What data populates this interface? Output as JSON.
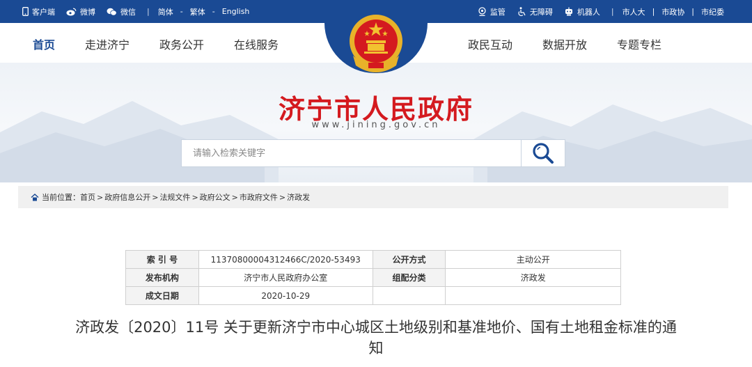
{
  "topbar": {
    "left": [
      {
        "icon": "mobile-icon",
        "label": "客户端"
      },
      {
        "icon": "weibo-icon",
        "label": "微博"
      },
      {
        "icon": "wechat-icon",
        "label": "微信"
      }
    ],
    "sep": "|",
    "lang": {
      "simplified": "简体",
      "dash": "-",
      "traditional": "繁体",
      "english": "English"
    },
    "right": [
      {
        "icon": "supervision-icon",
        "label": "监管"
      },
      {
        "icon": "accessibility-icon",
        "label": "无障碍"
      },
      {
        "icon": "robot-icon",
        "label": "机器人"
      }
    ],
    "links": [
      "市人大",
      "市政协",
      "市纪委"
    ]
  },
  "nav": {
    "left": [
      "首页",
      "走进济宁",
      "政务公开",
      "在线服务"
    ],
    "right": [
      "政民互动",
      "数据开放",
      "专题专栏"
    ],
    "active": "首页"
  },
  "banner": {
    "title": "济宁市人民政府",
    "url": "www.jining.gov.cn"
  },
  "search": {
    "placeholder": "请输入检索关键字"
  },
  "breadcrumb": {
    "prefix": "当前位置：",
    "items": [
      "首页",
      "政府信息公开",
      "法规文件",
      "政府公文",
      "市政府文件",
      "济政发"
    ],
    "sep": ">"
  },
  "info": {
    "rows": [
      [
        "索 引 号",
        "11370800004312466C/2020-53493",
        "公开方式",
        "主动公开"
      ],
      [
        "发布机构",
        "济宁市人民政府办公室",
        "组配分类",
        "济政发"
      ],
      [
        "成文日期",
        "2020-10-29",
        "",
        ""
      ]
    ]
  },
  "doc": {
    "title": "济政发〔2020〕11号 关于更新济宁市中心城区土地级别和基准地价、国有土地租金标准的通知"
  },
  "colors": {
    "primary": "#1a4a94",
    "title_red": "#d41a1f"
  }
}
